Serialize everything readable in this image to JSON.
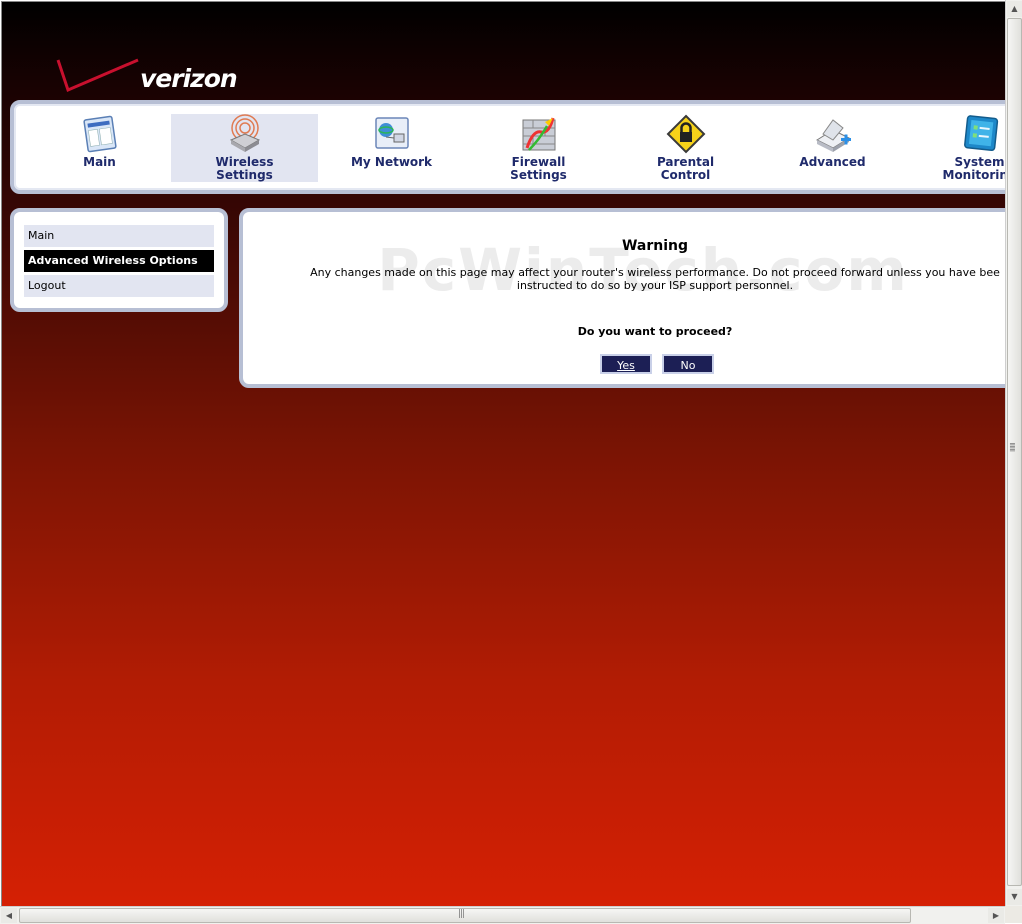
{
  "logo": {
    "text": "verizon"
  },
  "nav": [
    {
      "line1": "Main",
      "line2": "",
      "icon": "main-window-icon"
    },
    {
      "line1": "Wireless",
      "line2": "Settings",
      "icon": "wireless-router-icon",
      "active": true
    },
    {
      "line1": "My Network",
      "line2": "",
      "icon": "network-computers-icon"
    },
    {
      "line1": "Firewall",
      "line2": "Settings",
      "icon": "firewall-icon"
    },
    {
      "line1": "Parental",
      "line2": "Control",
      "icon": "padlock-warning-icon"
    },
    {
      "line1": "Advanced",
      "line2": "",
      "icon": "advanced-scanner-icon"
    },
    {
      "line1": "System",
      "line2": "Monitoring",
      "icon": "system-monitor-icon"
    }
  ],
  "side_menu": [
    {
      "label": "Main"
    },
    {
      "label": "Advanced Wireless Options",
      "selected": true
    },
    {
      "label": "Logout"
    }
  ],
  "watermark": "PcWinTech.com",
  "warning": {
    "title": "Warning",
    "line1": "Any changes made on this page may affect your router's wireless performance. Do not proceed forward unless you have bee",
    "line2": "instructed to do so by your ISP support personnel.",
    "question": "Do you want to proceed?",
    "yes_label": "Yes",
    "no_label": "No"
  },
  "colors": {
    "nav_text": "#1f2a6b",
    "panel_border": "#b7bfd4",
    "button_bg": "#1c1f55",
    "bg_top": "#000000",
    "bg_bottom": "#d52004"
  }
}
